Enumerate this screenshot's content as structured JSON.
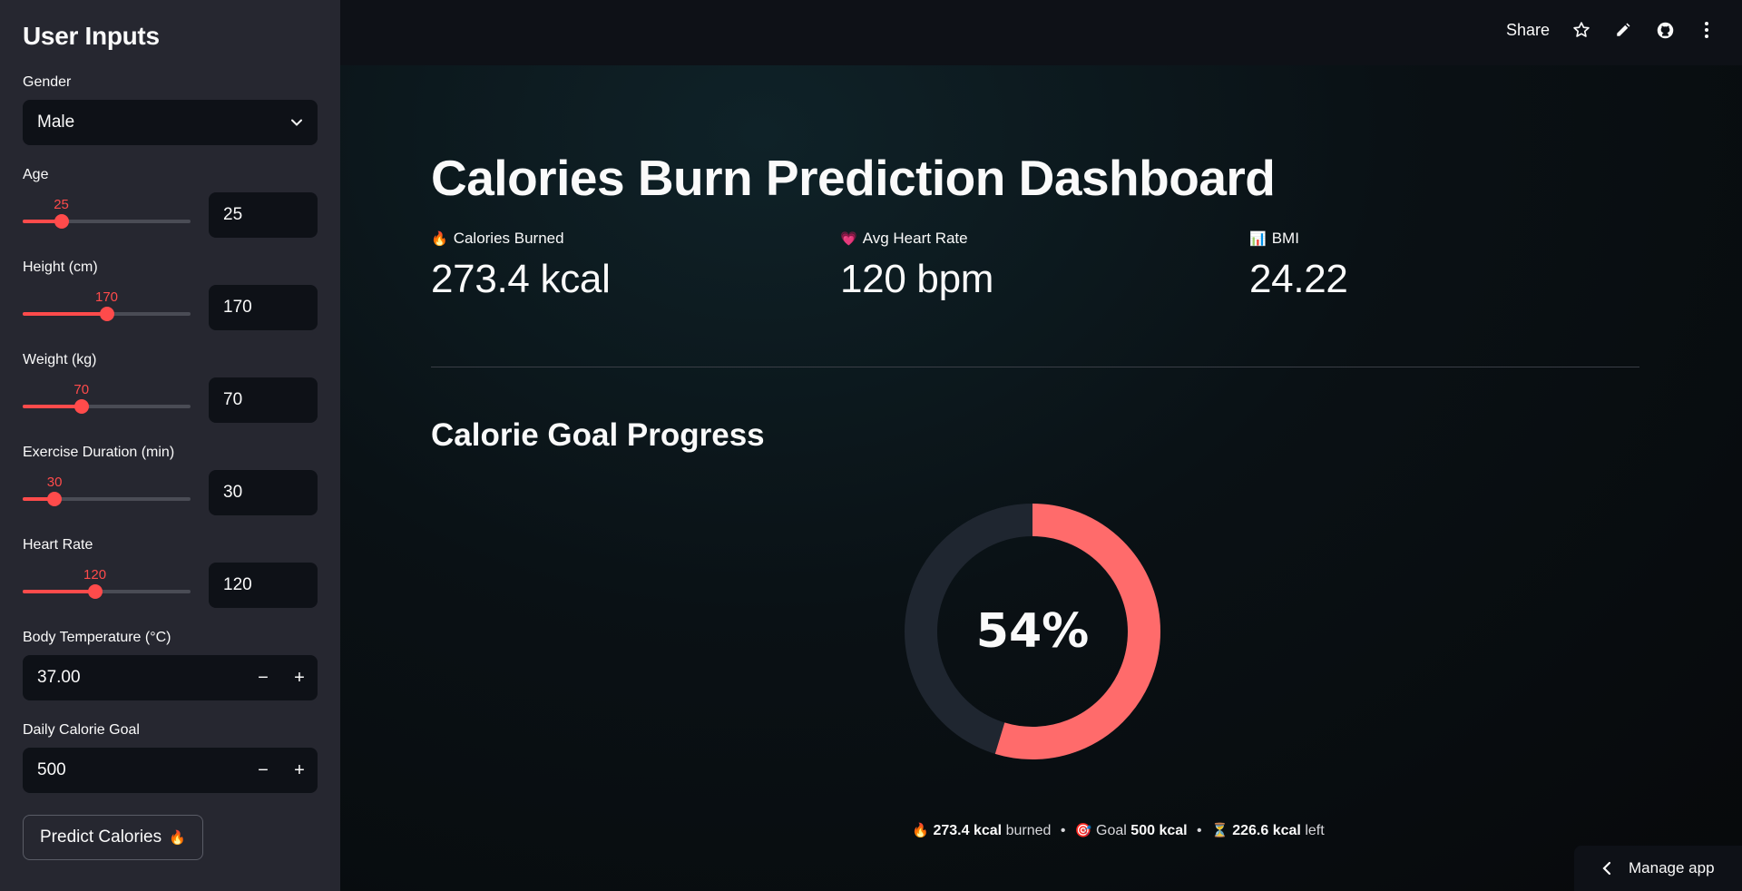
{
  "sidebar": {
    "title": "User Inputs",
    "gender": {
      "label": "Gender",
      "value": "Male"
    },
    "age": {
      "label": "Age",
      "value": "25",
      "fraction": 0.23
    },
    "height": {
      "label": "Height (cm)",
      "value": "170",
      "fraction": 0.5
    },
    "weight": {
      "label": "Weight (kg)",
      "value": "70",
      "fraction": 0.35
    },
    "duration": {
      "label": "Exercise Duration (min)",
      "value": "30",
      "fraction": 0.19
    },
    "heart_rate": {
      "label": "Heart Rate",
      "value": "120",
      "fraction": 0.43
    },
    "body_temp": {
      "label": "Body Temperature (°C)",
      "value": "37.00"
    },
    "calorie_goal": {
      "label": "Daily Calorie Goal",
      "value": "500"
    },
    "predict_label": "Predict Calories",
    "predict_icon": "🔥"
  },
  "topbar": {
    "share": "Share"
  },
  "main": {
    "title": "Calories Burn Prediction Dashboard",
    "metrics": [
      {
        "icon": "🔥",
        "label": "Calories Burned",
        "value": "273.4 kcal"
      },
      {
        "icon": "💗",
        "label": "Avg Heart Rate",
        "value": "120 bpm"
      },
      {
        "icon": "📊",
        "label": "BMI",
        "value": "24.22"
      }
    ],
    "section_title": "Calorie Goal Progress",
    "progress": {
      "percent_label": "54%",
      "fraction": 0.547
    },
    "summary": {
      "burned_icon": "🔥",
      "burned_value": "273.4 kcal",
      "burned_text": "burned",
      "goal_icon": "🎯",
      "goal_text": "Goal",
      "goal_value": "500 kcal",
      "left_icon": "⏳",
      "left_value": "226.6 kcal",
      "left_text": "left",
      "separator": "•"
    },
    "manage_app": "Manage app"
  },
  "colors": {
    "accent": "#ff4b4b",
    "donut_fill": "#ff6b6b",
    "donut_track": "#1f2630"
  }
}
